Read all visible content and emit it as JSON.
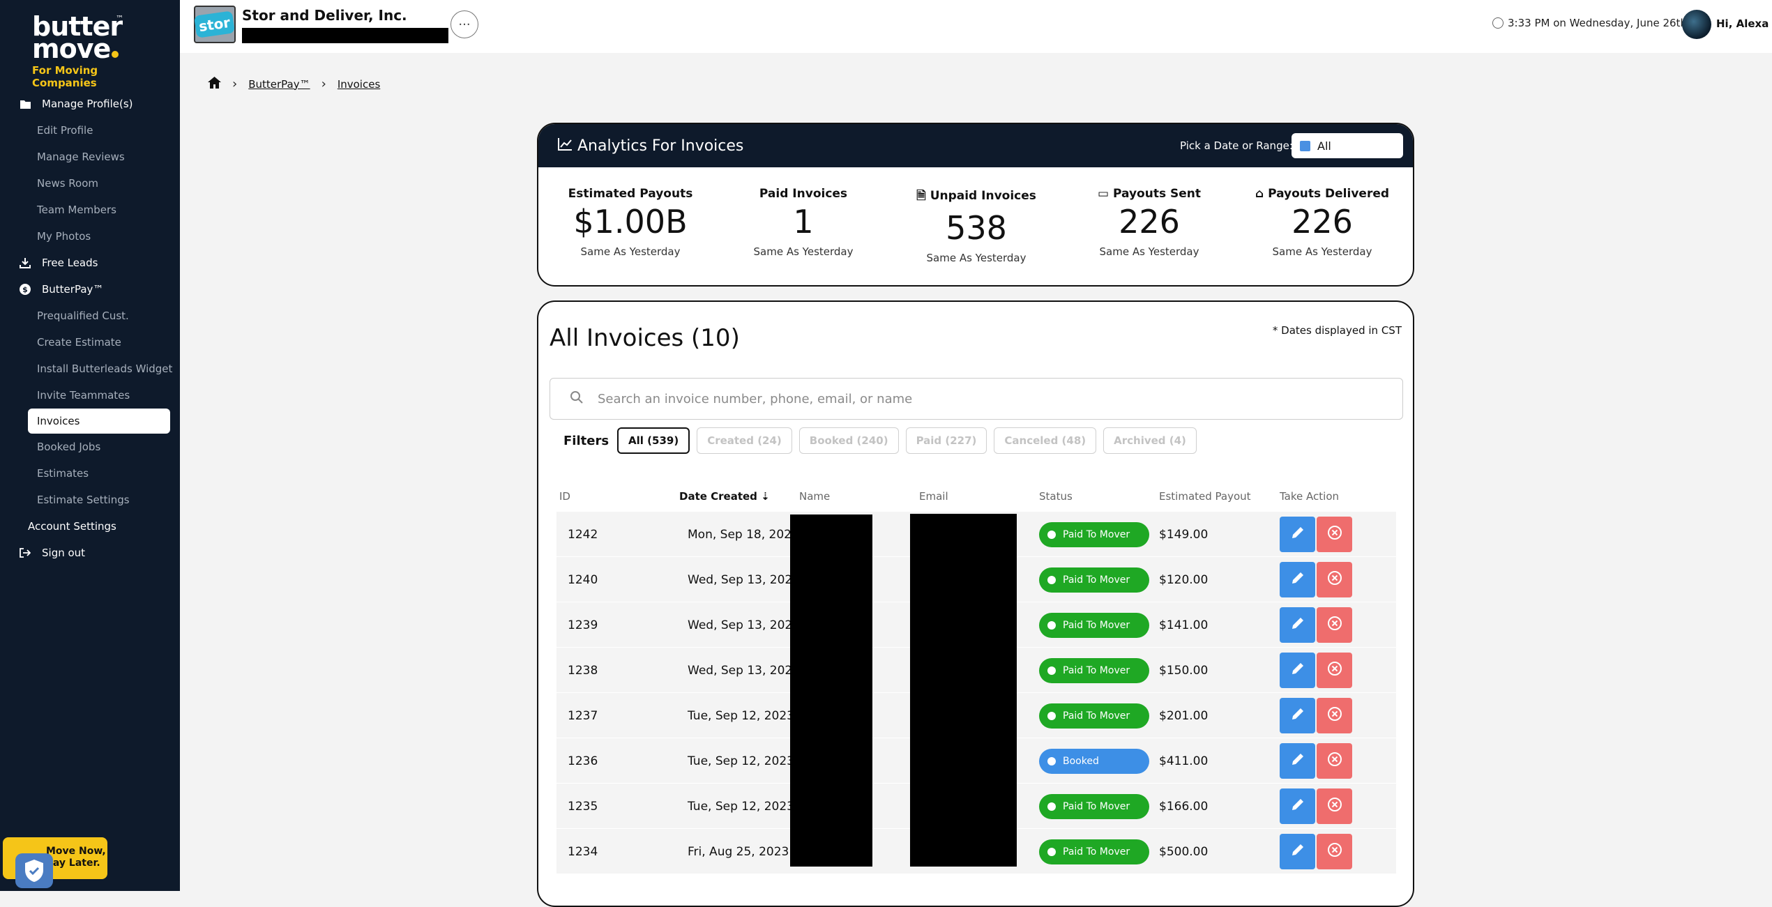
{
  "brand": {
    "name": "butter move",
    "tm": "™",
    "tagline": "For Moving Companies"
  },
  "sidebar": {
    "sections": [
      {
        "label": "Manage Profile(s)",
        "icon": "folder-icon",
        "items": [
          "Edit Profile",
          "Manage Reviews",
          "News Room",
          "Team Members",
          "My Photos"
        ]
      },
      {
        "label": "Free Leads",
        "icon": "download-icon",
        "items": []
      },
      {
        "label": "ButterPay™",
        "icon": "dollar-icon",
        "items": [
          "Prequalified Cust.",
          "Create Estimate",
          "Install Butterleads Widget",
          "Invite Teammates",
          "Invoices",
          "Booked Jobs",
          "Estimates",
          "Estimate Settings"
        ]
      }
    ],
    "active_item": "Invoices",
    "account_settings": "Account Settings",
    "sign_out": "Sign out",
    "promo": "Move Now, Pay Later."
  },
  "topbar": {
    "company_name": "Stor and Deliver, Inc.",
    "company_logo_text": "stor",
    "datetime": "3:33 PM on Wednesday, June 26th",
    "greeting": "Hi, Alexa"
  },
  "breadcrumb": {
    "items": [
      "ButterPay™",
      "Invoices"
    ]
  },
  "analytics": {
    "title": "Analytics For Invoices",
    "date_label": "Pick a Date or Range:",
    "date_value": "All",
    "stats": [
      {
        "label": "Estimated Payouts",
        "value": "$1.00B",
        "sub": "Same As Yesterday",
        "icon": ""
      },
      {
        "label": "Paid Invoices",
        "value": "1",
        "sub": "Same As Yesterday",
        "icon": ""
      },
      {
        "label": "Unpaid Invoices",
        "value": "538",
        "sub": "Same As Yesterday",
        "icon": "document-icon"
      },
      {
        "label": "Payouts Sent",
        "value": "226",
        "sub": "Same As Yesterday",
        "icon": "money-icon"
      },
      {
        "label": "Payouts Delivered",
        "value": "226",
        "sub": "Same As Yesterday",
        "icon": "house-icon"
      }
    ]
  },
  "invoices": {
    "title": "All Invoices (10)",
    "note": "* Dates displayed in CST",
    "search_placeholder": "Search an invoice number, phone, email, or name",
    "filters_label": "Filters",
    "filters": [
      "All (539)",
      "Created (24)",
      "Booked (240)",
      "Paid (227)",
      "Canceled (48)",
      "Archived (4)"
    ],
    "columns": [
      "ID",
      "Date Created",
      "Name",
      "Email",
      "Status",
      "Estimated Payout",
      "Take Action"
    ],
    "rows": [
      {
        "id": "1242",
        "date": "Mon, Sep 18, 2023",
        "status": "Paid To Mover",
        "payout": "$149.00"
      },
      {
        "id": "1240",
        "date": "Wed, Sep 13, 2023",
        "status": "Paid To Mover",
        "payout": "$120.00"
      },
      {
        "id": "1239",
        "date": "Wed, Sep 13, 2023",
        "status": "Paid To Mover",
        "payout": "$141.00"
      },
      {
        "id": "1238",
        "date": "Wed, Sep 13, 2023",
        "status": "Paid To Mover",
        "payout": "$150.00"
      },
      {
        "id": "1237",
        "date": "Tue, Sep 12, 2023",
        "status": "Paid To Mover",
        "payout": "$201.00"
      },
      {
        "id": "1236",
        "date": "Tue, Sep 12, 2023",
        "status": "Booked",
        "payout": "$411.00"
      },
      {
        "id": "1235",
        "date": "Tue, Sep 12, 2023",
        "status": "Paid To Mover",
        "payout": "$166.00"
      },
      {
        "id": "1234",
        "date": "Fri, Aug 25, 2023",
        "status": "Paid To Mover",
        "payout": "$500.00"
      }
    ]
  },
  "colors": {
    "sidebar_bg": "#0e1a2b",
    "accent_yellow": "#f5c518",
    "paid": "#1fa824",
    "booked": "#3d8fe6",
    "edit": "#3d8fe6",
    "delete": "#ef6d6d"
  }
}
